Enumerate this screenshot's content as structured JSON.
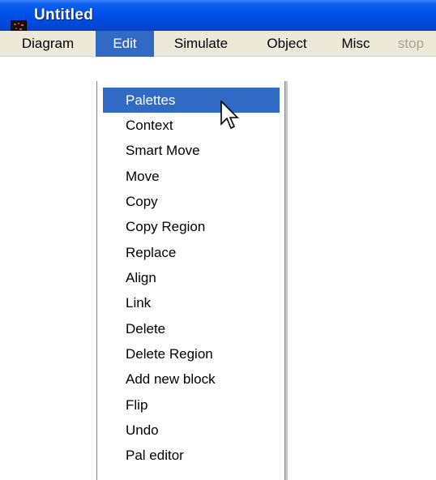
{
  "window": {
    "title": "Untitled"
  },
  "icons": {
    "app": "app-diagram-icon",
    "pointer": "mouse-pointer-icon"
  },
  "colors": {
    "titlebar": "#0050e8",
    "menubar": "#ece9d8",
    "highlight": "#316ac5",
    "disabled_text": "#a6a396"
  },
  "menubar": {
    "items": [
      {
        "label": "Diagram",
        "state": "normal"
      },
      {
        "label": "Edit",
        "state": "open"
      },
      {
        "label": "Simulate",
        "state": "normal"
      },
      {
        "label": "Object",
        "state": "normal"
      },
      {
        "label": "Misc",
        "state": "normal"
      },
      {
        "label": "stop",
        "state": "disabled"
      }
    ]
  },
  "edit_menu": {
    "highlighted": "Palettes",
    "items": [
      "Palettes",
      "Context",
      "Smart Move",
      "Move",
      "Copy",
      "Copy Region",
      "Replace",
      "Align",
      "Link",
      "Delete",
      "Delete Region",
      "Add new block",
      "Flip",
      "Undo",
      "Pal editor"
    ]
  }
}
